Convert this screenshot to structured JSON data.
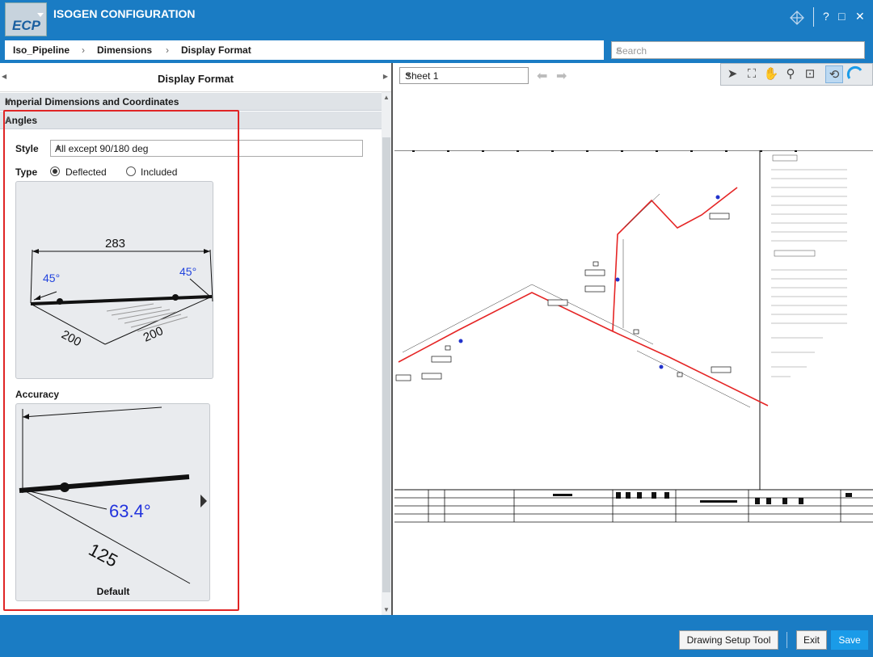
{
  "app": {
    "title": "ISOGEN CONFIGURATION",
    "logo": "ECP",
    "accent": "#1a7cc4"
  },
  "window": {
    "help": "?",
    "maximize": "□",
    "close": "✕"
  },
  "breadcrumb": [
    "Iso_Pipeline",
    "Dimensions",
    "Display Format"
  ],
  "search": {
    "placeholder": "Search"
  },
  "panel": {
    "title": "Display Format",
    "sections": [
      {
        "label": "Imperial Dimensions and Coordinates",
        "chevron": "∨"
      },
      {
        "label": "Angles",
        "chevron": "∧"
      }
    ],
    "angles": {
      "style_label": "Style",
      "style_value": "All except 90/180 deg",
      "type_label": "Type",
      "type_options": [
        {
          "label": "Deflected",
          "selected": true
        },
        {
          "label": "Included",
          "selected": false
        }
      ],
      "preview": {
        "dim": "283",
        "angle_left": "45°",
        "angle_right": "45°",
        "leg_left": "200",
        "leg_right": "200"
      },
      "accuracy_label": "Accuracy",
      "accuracy": {
        "angle": "63.4°",
        "length": "125",
        "caption": "Default"
      }
    }
  },
  "drawing": {
    "sheet": "Sheet 1"
  },
  "footer": {
    "setup": "Drawing Setup Tool",
    "exit": "Exit",
    "save": "Save"
  }
}
